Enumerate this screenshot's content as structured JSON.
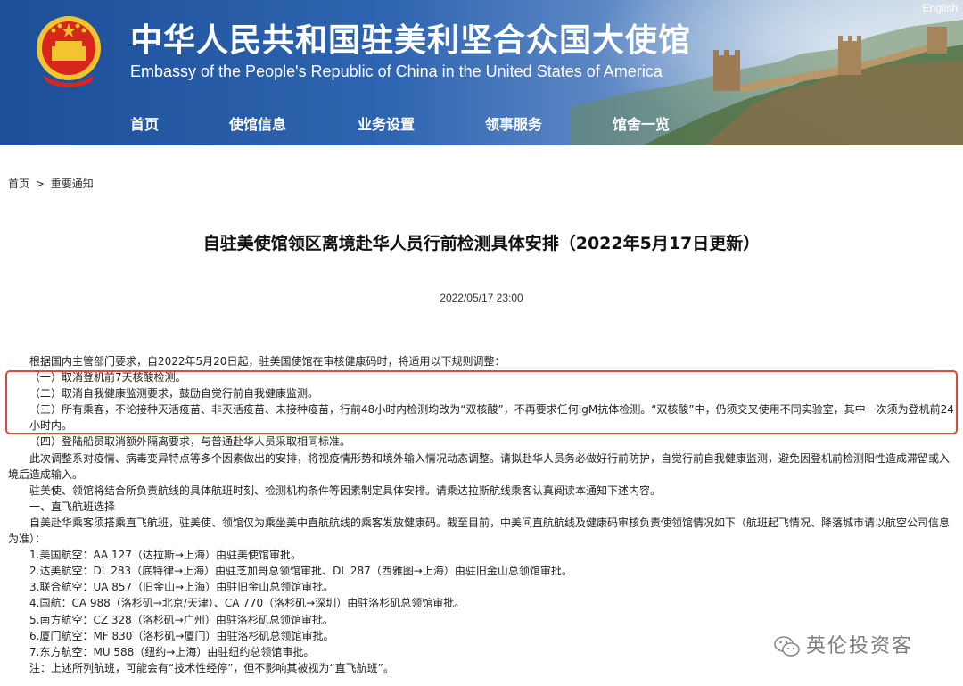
{
  "header": {
    "title_cn": "中华人民共和国驻美利坚合众国大使馆",
    "title_en": "Embassy of the People's Republic of China in the United States of America",
    "english_link": "English",
    "nav": [
      "首页",
      "使馆信息",
      "业务设置",
      "领事服务",
      "馆舍一览"
    ]
  },
  "breadcrumb": {
    "home": "首页",
    "sep": ">",
    "current": "重要通知"
  },
  "article": {
    "title": "自驻美使馆领区离境赴华人员行前检测具体安排（2022年5月17日更新）",
    "date": "2022/05/17 23:00",
    "paragraphs": [
      "根据国内主管部门要求，自2022年5月20日起，驻美国使馆在审核健康码时，将适用以下规则调整：",
      "（一）取消登机前7天核酸检测。",
      "（二）取消自我健康监测要求，鼓励自觉行前自我健康监测。",
      "（三）所有乘客，不论接种灭活疫苗、非灭活疫苗、未接种疫苗，行前48小时内检测均改为“双核酸”，不再要求任何IgM抗体检测。“双核酸”中，仍须交叉使用不同实验室，其中一次须为登机前24小时内。",
      "（四）登陆船员取消额外隔离要求，与普通赴华人员采取相同标准。",
      "此次调整系对疫情、病毒变异特点等多个因素做出的安排，将视疫情形势和境外输入情况动态调整。请拟赴华人员务必做好行前防护，自觉行前自我健康监测，避免因登机前检测阳性造成滞留或入境后造成输入。",
      "驻美使、领馆将结合所负责航线的具体航班时刻、检测机构条件等因素制定具体安排。请乘达拉斯航线乘客认真阅读本通知下述内容。",
      "一、直飞航班选择",
      "自美赴华乘客须搭乘直飞航班，驻美使、领馆仅为乘坐美中直航航线的乘客发放健康码。截至目前，中美间直航航线及健康码审核负责使领馆情况如下（航班起飞情况、降落城市请以航空公司信息为准）：",
      "1.美国航空：AA 127（达拉斯→上海）由驻美使馆审批。",
      "2.达美航空：DL 283（底特律→上海）由驻芝加哥总领馆审批、DL 287（西雅图→上海）由驻旧金山总领馆审批。",
      "3.联合航空：UA 857（旧金山→上海）由驻旧金山总领馆审批。",
      "4.国航：CA 988（洛杉矶→北京/天津）、CA 770（洛杉矶→深圳）由驻洛杉矶总领馆审批。",
      "5.南方航空：CZ 328（洛杉矶→广州）由驻洛杉矶总领馆审批。",
      "6.厦门航空：MF 830（洛杉矶→厦门）由驻洛杉矶总领馆审批。",
      "7.东方航空：MU 588（纽约→上海）由驻纽约总领馆审批。",
      "注：上述所列航班，可能会有“技术性经停”，但不影响其被视为“直飞航班”。"
    ]
  },
  "watermark": {
    "text": "英伦投资客",
    "icon": "wechat-icon"
  },
  "colors": {
    "banner": "#2e64b0",
    "highlight_border": "#e04a3c",
    "emblem_red": "#d8261c",
    "emblem_gold": "#f2c530"
  }
}
